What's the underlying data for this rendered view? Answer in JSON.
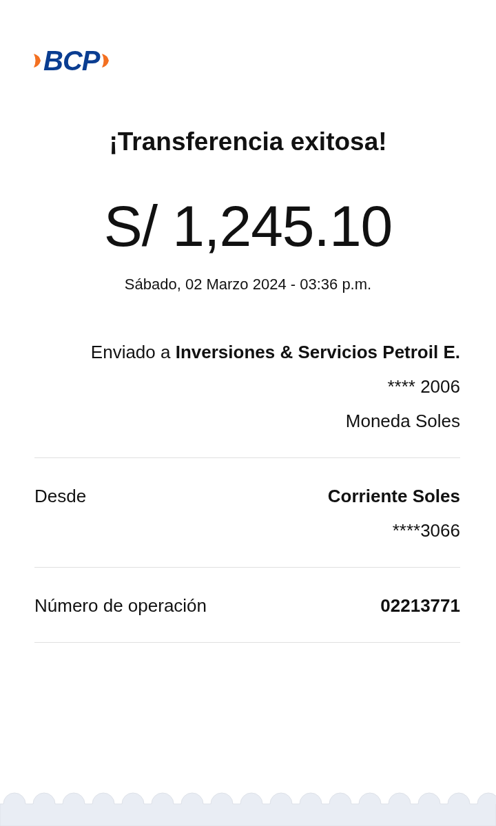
{
  "logo": {
    "text": "BCP"
  },
  "title": "¡Transferencia exitosa!",
  "amount": "S/ 1,245.10",
  "datetime": "Sábado, 02 Marzo 2024 - 03:36 p.m.",
  "recipient": {
    "sentence": "Enviado a **Inversiones & Servicios Petroil E.**",
    "account": "**** 2006",
    "currency": "Moneda Soles"
  },
  "rows": [
    {
      "label": "Desde",
      "value": "Corriente Soles",
      "sub": "****3066"
    },
    {
      "label": "Número de operación",
      "value": "02213771"
    }
  ]
}
